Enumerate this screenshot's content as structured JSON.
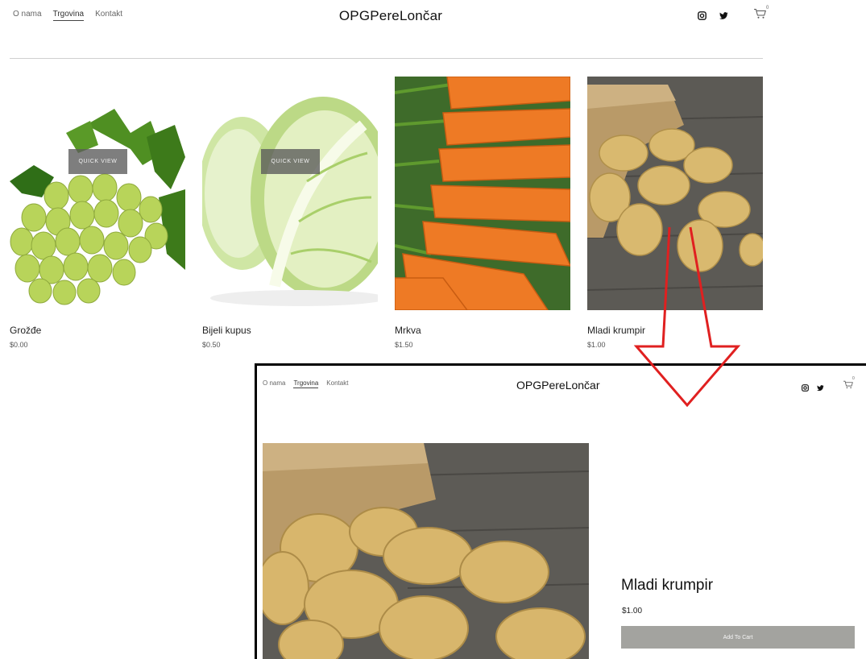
{
  "header": {
    "nav": [
      "O nama",
      "Trgovina",
      "Kontakt"
    ],
    "active_nav": "Trgovina",
    "brand": "OPGPereLončar",
    "cart_count": "0"
  },
  "products": [
    {
      "name": "Grožđe",
      "price": "$0.00",
      "quick_view": "QUICK VIEW"
    },
    {
      "name": "Bijeli kupus",
      "price": "$0.50",
      "quick_view": "QUICK VIEW"
    },
    {
      "name": "Mrkva",
      "price": "$1.50"
    },
    {
      "name": "Mladi krumpir",
      "price": "$1.00"
    }
  ],
  "detail": {
    "nav": [
      "O nama",
      "Trgovina",
      "Kontakt"
    ],
    "brand": "OPGPereLončar",
    "cart_count": "0",
    "title": "Mladi krumpir",
    "price": "$1.00",
    "add_to_cart": "Add To Cart"
  },
  "icons": [
    "instagram-icon",
    "twitter-icon",
    "cart-icon"
  ],
  "colors": {
    "arrow": "#e02020",
    "button": "#a3a39f"
  }
}
